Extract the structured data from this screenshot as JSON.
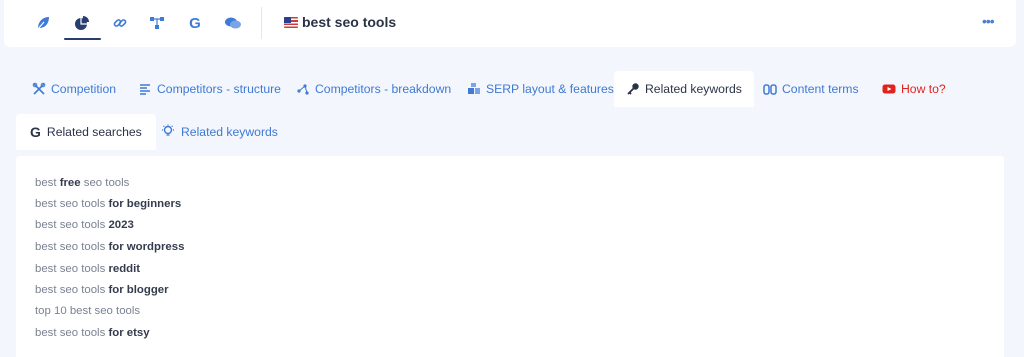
{
  "toolbar": {
    "icons": [
      {
        "name": "leaf-icon"
      },
      {
        "name": "pie-chart-icon",
        "active": true
      },
      {
        "name": "link-icon"
      },
      {
        "name": "network-icon"
      },
      {
        "name": "google-icon"
      },
      {
        "name": "chat-icon"
      }
    ],
    "flag": "us-flag-icon",
    "query": "best seo tools",
    "more_label": "•••"
  },
  "tabs": [
    {
      "label": "Competition",
      "icon": "crossed-tools-icon"
    },
    {
      "label": "Competitors - structure",
      "icon": "list-icon"
    },
    {
      "label": "Competitors - breakdown",
      "icon": "nodes-icon"
    },
    {
      "label": "SERP layout & features",
      "icon": "blocks-icon"
    },
    {
      "label": "Related keywords",
      "icon": "key-icon",
      "active": true
    },
    {
      "label": "Content terms",
      "icon": "binoculars-icon"
    },
    {
      "label": "How to?",
      "icon": "youtube-icon"
    }
  ],
  "subtabs": [
    {
      "label": "Related searches",
      "icon": "google-icon",
      "active": true
    },
    {
      "label": "Related keywords",
      "icon": "bulb-icon"
    }
  ],
  "related_searches": [
    {
      "plain": "best ",
      "bold": "free",
      "rest": " seo tools"
    },
    {
      "plain": "best seo tools ",
      "bold": "for beginners",
      "rest": ""
    },
    {
      "plain": "best seo tools ",
      "bold": "2023",
      "rest": ""
    },
    {
      "plain": "best seo tools ",
      "bold": "for wordpress",
      "rest": ""
    },
    {
      "plain": "best seo tools ",
      "bold": "reddit",
      "rest": ""
    },
    {
      "plain": "best seo tools ",
      "bold": "for blogger",
      "rest": ""
    },
    {
      "plain": "top 10 best seo tools",
      "bold": "",
      "rest": ""
    },
    {
      "plain": "best seo tools ",
      "bold": "for etsy",
      "rest": ""
    }
  ],
  "colors": {
    "accent": "#3f7ad3",
    "background": "#f3f6fc",
    "youtube_red": "#e0241c",
    "active_underline": "#2a3d70"
  }
}
